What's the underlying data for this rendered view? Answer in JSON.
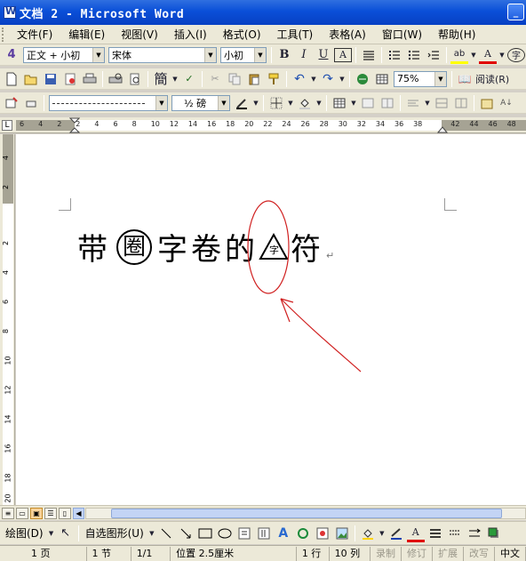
{
  "window": {
    "title": "文档 2 - Microsoft Word"
  },
  "menu": {
    "items": [
      "文件(F)",
      "编辑(E)",
      "视图(V)",
      "插入(I)",
      "格式(O)",
      "工具(T)",
      "表格(A)",
      "窗口(W)",
      "帮助(H)"
    ]
  },
  "format_toolbar": {
    "style": "正文 + 小初",
    "font": "宋体",
    "size": "小初",
    "bold": "B",
    "italic": "I",
    "underline": "U",
    "border_char": "A",
    "highlight": "ab",
    "font_color": "A",
    "enclose": "字"
  },
  "standard_toolbar": {
    "simplify": "簡",
    "zoom": "75%",
    "read": "阅读(R)"
  },
  "tables_toolbar": {
    "line_weight": "½ 磅"
  },
  "ruler": {
    "ticks": [
      "6",
      "4",
      "2",
      "2",
      "4",
      "6",
      "8",
      "10",
      "12",
      "14",
      "16",
      "18",
      "20",
      "22",
      "24",
      "26",
      "28",
      "30",
      "32",
      "34",
      "36",
      "38",
      "42",
      "44",
      "46",
      "48"
    ],
    "tab_selector": "L"
  },
  "vruler": {
    "ticks": [
      "4",
      "2",
      "2",
      "4",
      "6",
      "8",
      "10",
      "12",
      "14",
      "16",
      "18",
      "20"
    ]
  },
  "document": {
    "text_before": "带",
    "enclosed_char": "圈",
    "text_middle": "字卷的",
    "triangle_char": "字",
    "text_after": "符"
  },
  "drawing_toolbar": {
    "draw": "绘图(D)",
    "autoshape": "自选图形(U)"
  },
  "statusbar": {
    "page": "1 页",
    "section": "1 节",
    "pages": "1/1",
    "position": "位置 2.5厘米",
    "line": "1 行",
    "column": "10 列",
    "rec": "录制",
    "trk": "修订",
    "ext": "扩展",
    "ovr": "改写",
    "lang": "中文"
  }
}
